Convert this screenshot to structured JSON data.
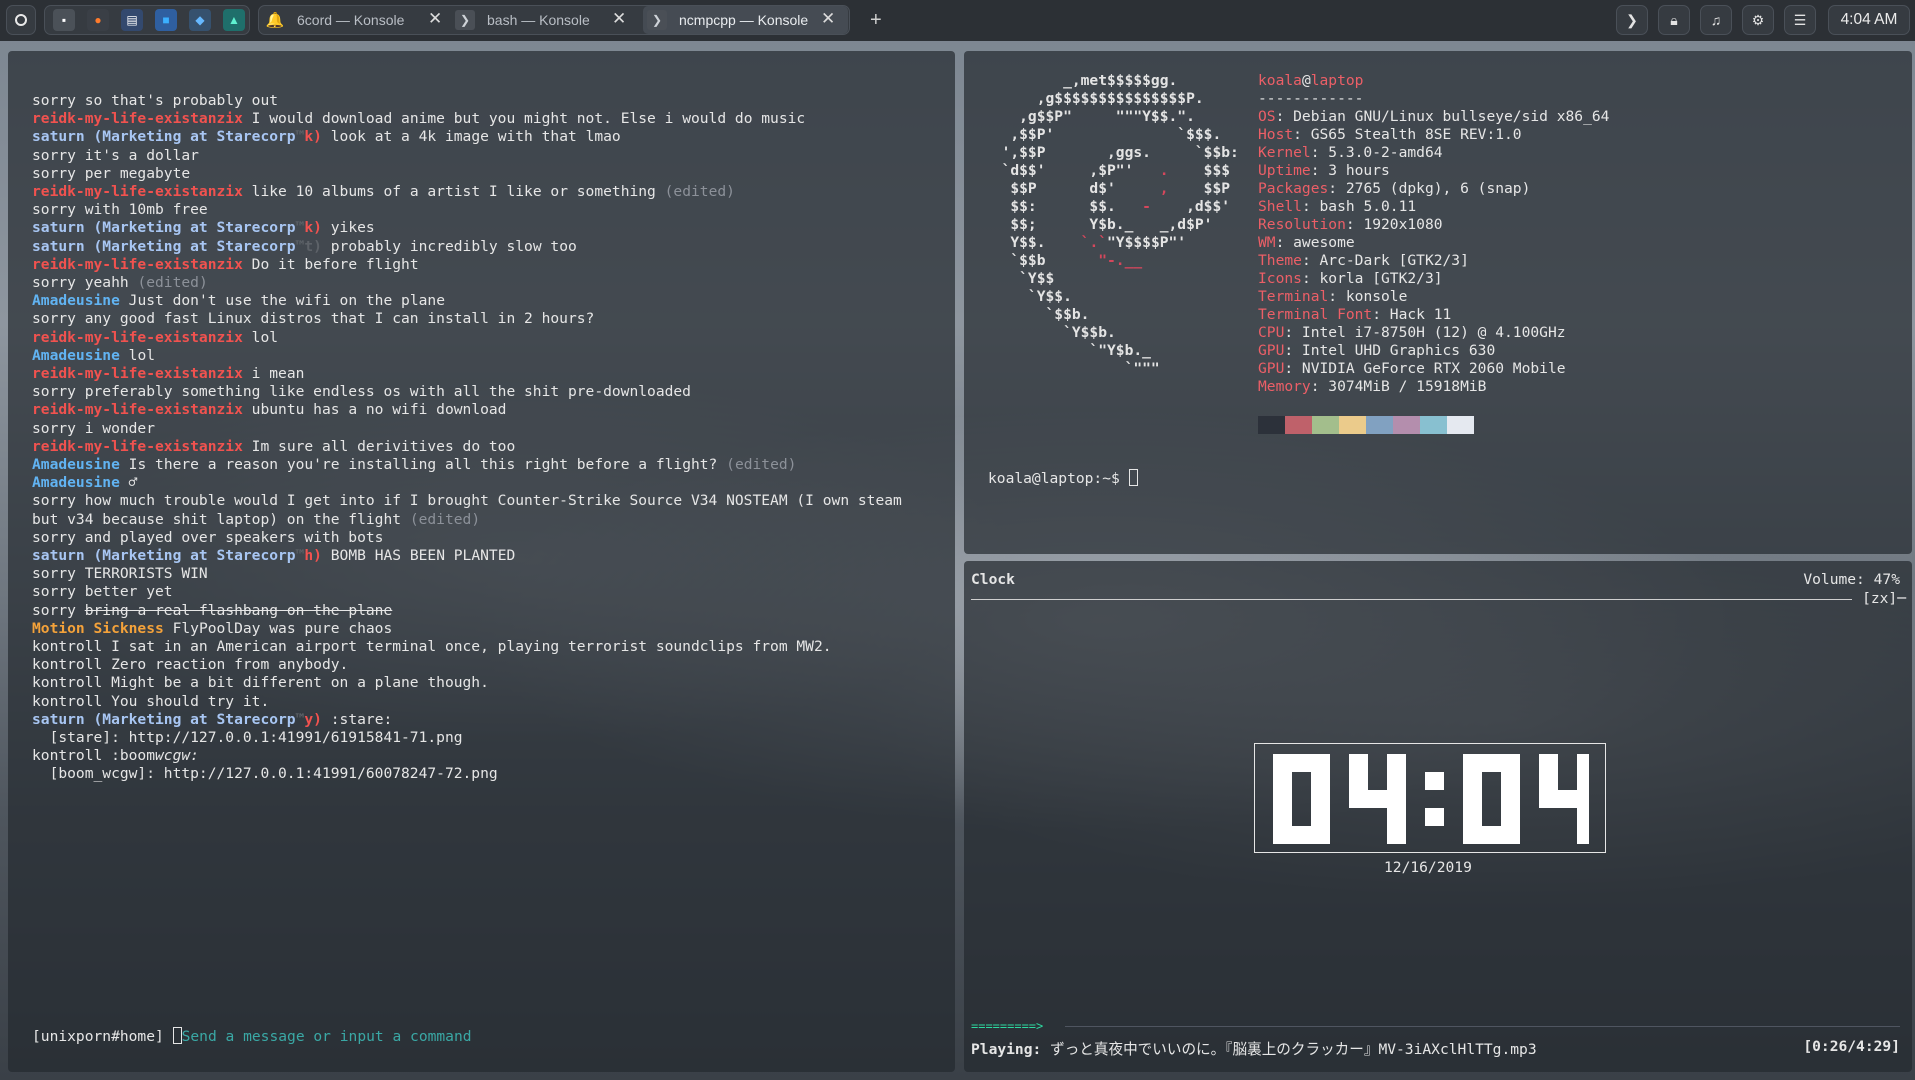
{
  "topbar": {
    "tasks": [
      {
        "label": "6cord — Konsole"
      },
      {
        "label": "bash — Konsole"
      },
      {
        "label": "ncmpcpp — Konsole"
      }
    ],
    "new_tab_label": "+",
    "clock": "4:04 AM"
  },
  "chat": {
    "channel": "[unixporn#home]",
    "placeholder": "Send a message or input a command",
    "lines": [
      {
        "text": "sorry so that's probably out"
      },
      {
        "nick": "reidk-my-life-existanzix",
        "text": "I would download anime but you might not. Else i would do music"
      },
      {
        "nick": "saturn (Marketing at Starecorp",
        "suffix": "k)",
        "text": "look at a 4k image with that lmao"
      },
      {
        "text": "sorry it's a dollar"
      },
      {
        "text": "sorry per megabyte"
      },
      {
        "nick": "reidk-my-life-existanzix",
        "text": "like 10 albums of a artist I like or something",
        "edited": "(edited)"
      },
      {
        "text": "sorry with 10mb free"
      },
      {
        "nick": "saturn (Marketing at Starecorp",
        "suffix": "k)",
        "text": "yikes"
      },
      {
        "nick": "saturn (Marketing at Starecorp",
        "suffix": "t)",
        "text": "probably incredibly slow too"
      },
      {
        "nick": "reidk-my-life-existanzix",
        "text": "Do it before flight"
      },
      {
        "text": "sorry yeahh",
        "edited": "(edited)"
      },
      {
        "nick": "Amadeusine",
        "text": "Just don't use the wifi on the plane"
      },
      {
        "text": "sorry any good fast Linux distros that I can install in 2 hours?"
      },
      {
        "nick": "reidk-my-life-existanzix",
        "text": "lol"
      },
      {
        "nick": "Amadeusine",
        "text": "lol"
      },
      {
        "nick": "reidk-my-life-existanzix",
        "text": "i mean"
      },
      {
        "text": "sorry preferably something like endless os with all the shit pre-downloaded"
      },
      {
        "nick": "reidk-my-life-existanzix",
        "text": "ubuntu has a no wifi download"
      },
      {
        "text": "sorry i wonder"
      },
      {
        "nick": "reidk-my-life-existanzix",
        "text": "Im sure all derivitives do too"
      },
      {
        "nick": "Amadeusine",
        "text": "Is there a reason you're installing all this right before a flight?",
        "edited": "(edited)"
      },
      {
        "nick": "Amadeusine",
        "text": "♂"
      },
      {
        "text": "sorry how much trouble would I get into if I brought Counter-Strike Source V34 NOSTEAM (I own steam"
      },
      {
        "text": "but v34 because shit laptop) on the flight",
        "edited": "(edited)"
      },
      {
        "text": "sorry and played over speakers with bots"
      },
      {
        "nick": "saturn (Marketing at Starecorp",
        "suffix": "h)",
        "text": "BOMB HAS BEEN PLANTED"
      },
      {
        "text": "sorry TERRORISTS WIN"
      },
      {
        "text": "sorry better yet"
      },
      {
        "text": "sorry",
        "strike": "bring a real flashbang on the plane"
      },
      {
        "nick": "Motion Sickness",
        "text": "FlyPoolDay was pure chaos"
      },
      {
        "text": "kontroll I sat in an American airport terminal once, playing terrorist soundclips from MW2."
      },
      {
        "text": "kontroll Zero reaction from anybody."
      },
      {
        "text": "kontroll Might be a bit different on a plane though."
      },
      {
        "text": "kontroll You should try it."
      },
      {
        "nick": "saturn (Marketing at Starecorp",
        "suffix": "y)",
        "text": ":stare:"
      },
      {
        "text": "  [stare]: http://127.0.0.1:41991/61915841-71.png"
      },
      {
        "text": "kontroll :boom",
        "italic": "wcgw:"
      },
      {
        "text": "  [boom_wcgw]: http://127.0.0.1:41991/60078247-72.png"
      }
    ]
  },
  "neofetch": {
    "user": "koala",
    "at": "@",
    "host": "laptop",
    "separator": "------------",
    "info": [
      {
        "key": "OS",
        "value": "Debian GNU/Linux bullseye/sid x86_64"
      },
      {
        "key": "Host",
        "value": "GS65 Stealth 8SE REV:1.0"
      },
      {
        "key": "Kernel",
        "value": "5.3.0-2-amd64"
      },
      {
        "key": "Uptime",
        "value": "3 hours"
      },
      {
        "key": "Packages",
        "value": "2765 (dpkg), 6 (snap)"
      },
      {
        "key": "Shell",
        "value": "bash 5.0.11"
      },
      {
        "key": "Resolution",
        "value": "1920x1080"
      },
      {
        "key": "WM",
        "value": "awesome"
      },
      {
        "key": "Theme",
        "value": "Arc-Dark [GTK2/3]"
      },
      {
        "key": "Icons",
        "value": "korla [GTK2/3]"
      },
      {
        "key": "Terminal",
        "value": "konsole"
      },
      {
        "key": "Terminal Font",
        "value": "Hack 11"
      },
      {
        "key": "CPU",
        "value": "Intel i7-8750H (12) @ 4.100GHz"
      },
      {
        "key": "GPU",
        "value": "Intel UHD Graphics 630"
      },
      {
        "key": "GPU",
        "value": "NVIDIA GeForce RTX 2060 Mobile"
      },
      {
        "key": "Memory",
        "value": "3074MiB / 15918MiB"
      }
    ],
    "palette": [
      "#2c313a",
      "#bf616a",
      "#a3be8c",
      "#ebcb8b",
      "#81a1c1",
      "#b48ead",
      "#88c0d0",
      "#e5e9f0"
    ],
    "prompt": "koala@laptop:~$ ",
    "logo": [
      "         _,met$$$$$gg.",
      "      ,g$$$$$$$$$$$$$$$P.",
      "    ,g$$P\"     \"\"\"Y$$.\".",
      "   ,$$P'              `$$$.",
      "  ',$$P       ,ggs.     `$$b:",
      "  `d$$'     ,$P\"'   .    $$$",
      "   $$P      d$'     ,    $$P",
      "   $$:      $$.   -    ,d$$'",
      "   $$;      Y$b._   _,d$P'",
      "   Y$$.    `.`\"Y$$$$P\"'",
      "   `$$b      \"-.__",
      "    `Y$$",
      "     `Y$$.",
      "       `$$b.",
      "         `Y$$b.",
      "            `\"Y$b._",
      "                `\"\"\""
    ]
  },
  "ncmpcpp": {
    "title": "Clock",
    "volume": "Volume: 47%",
    "tag": "[zx]─",
    "time": "04:04",
    "date": "12/16/2019",
    "progress_bar": "=========>",
    "progress": 0.1,
    "status_label": "Playing:",
    "track": "ずっと真夜中でいいのに。『脳裏上のクラッカー』MV-3iAXclHlTTg.mp3",
    "elapsed": "[0:26/4:29]"
  }
}
